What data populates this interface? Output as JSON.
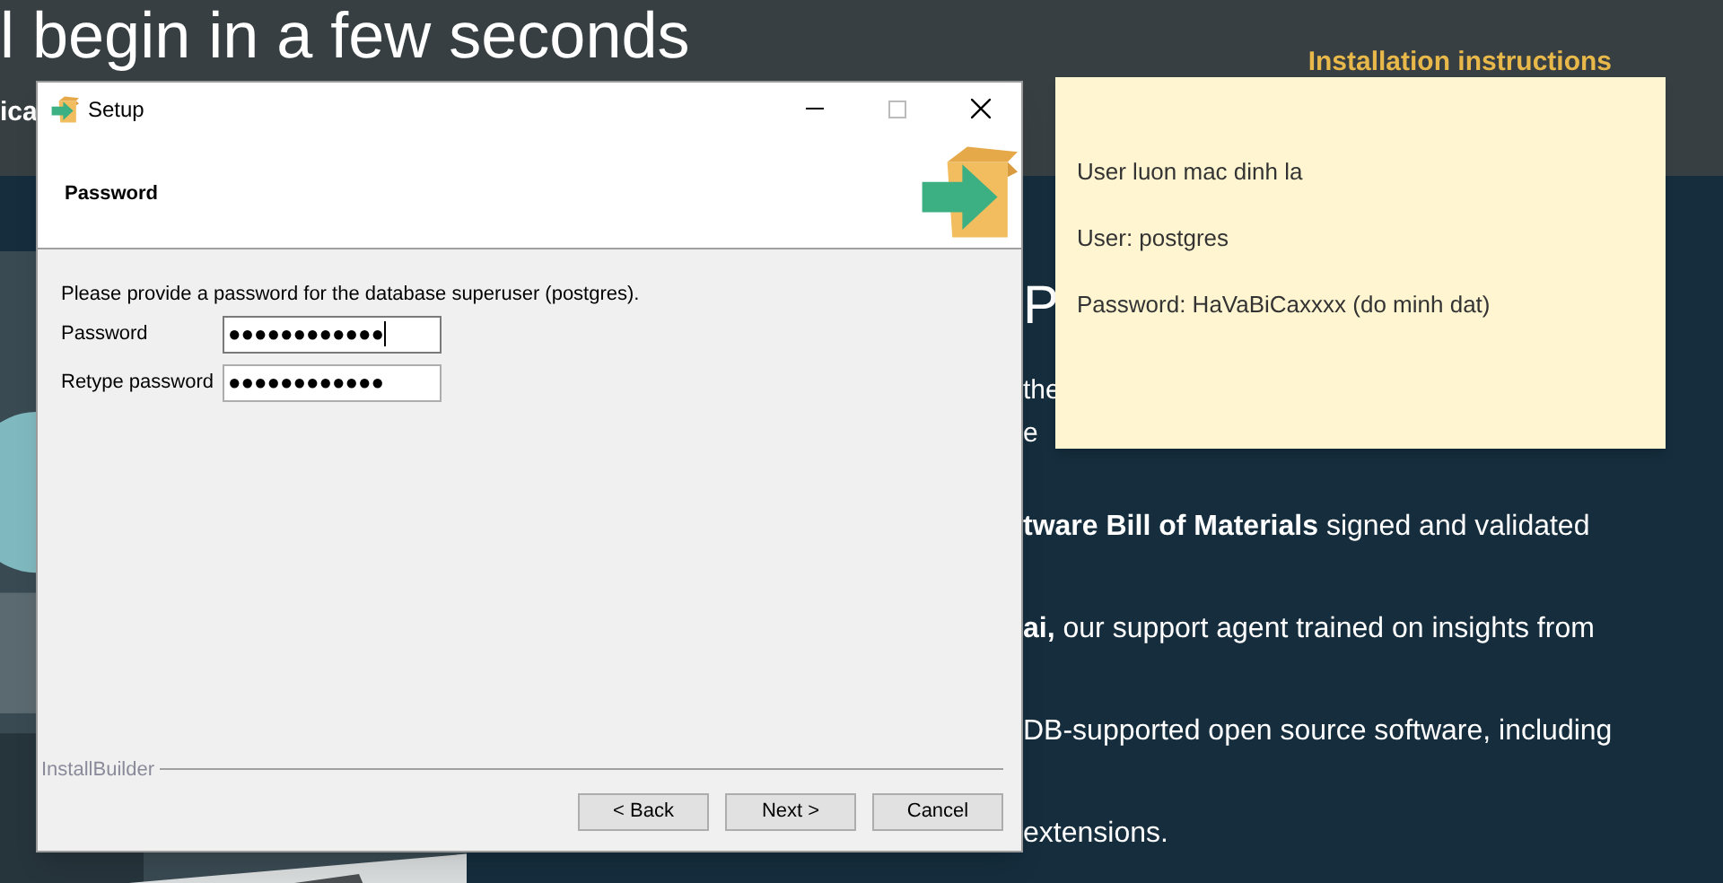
{
  "page": {
    "heading": "l begin in a few seconds",
    "subheading": "ica",
    "nav_link": "Installation instructions",
    "right_heading": "P",
    "paragraph_lines": [
      "the",
      "e"
    ],
    "features": [
      "**tware Bill of Materials** signed and validated",
      "**ai,** our support agent trained on insights from",
      "DB-supported open source software, including",
      "extensions."
    ]
  },
  "setup_window": {
    "title": "Setup",
    "header": "Password",
    "prompt": "Please provide a password for the database superuser (postgres).",
    "fields": [
      {
        "label": "Password",
        "value": "●●●●●●●●●●●●",
        "focused": true
      },
      {
        "label": "Retype password",
        "value": "●●●●●●●●●●●●",
        "focused": false
      }
    ],
    "footer_brand": "InstallBuilder",
    "buttons": [
      "< Back",
      "Next >",
      "Cancel"
    ]
  },
  "sticky_note": {
    "lines": [
      "User luon mac dinh la",
      "User: postgres",
      "Password: HaVaBiCaxxxx (do minh dat)"
    ]
  }
}
